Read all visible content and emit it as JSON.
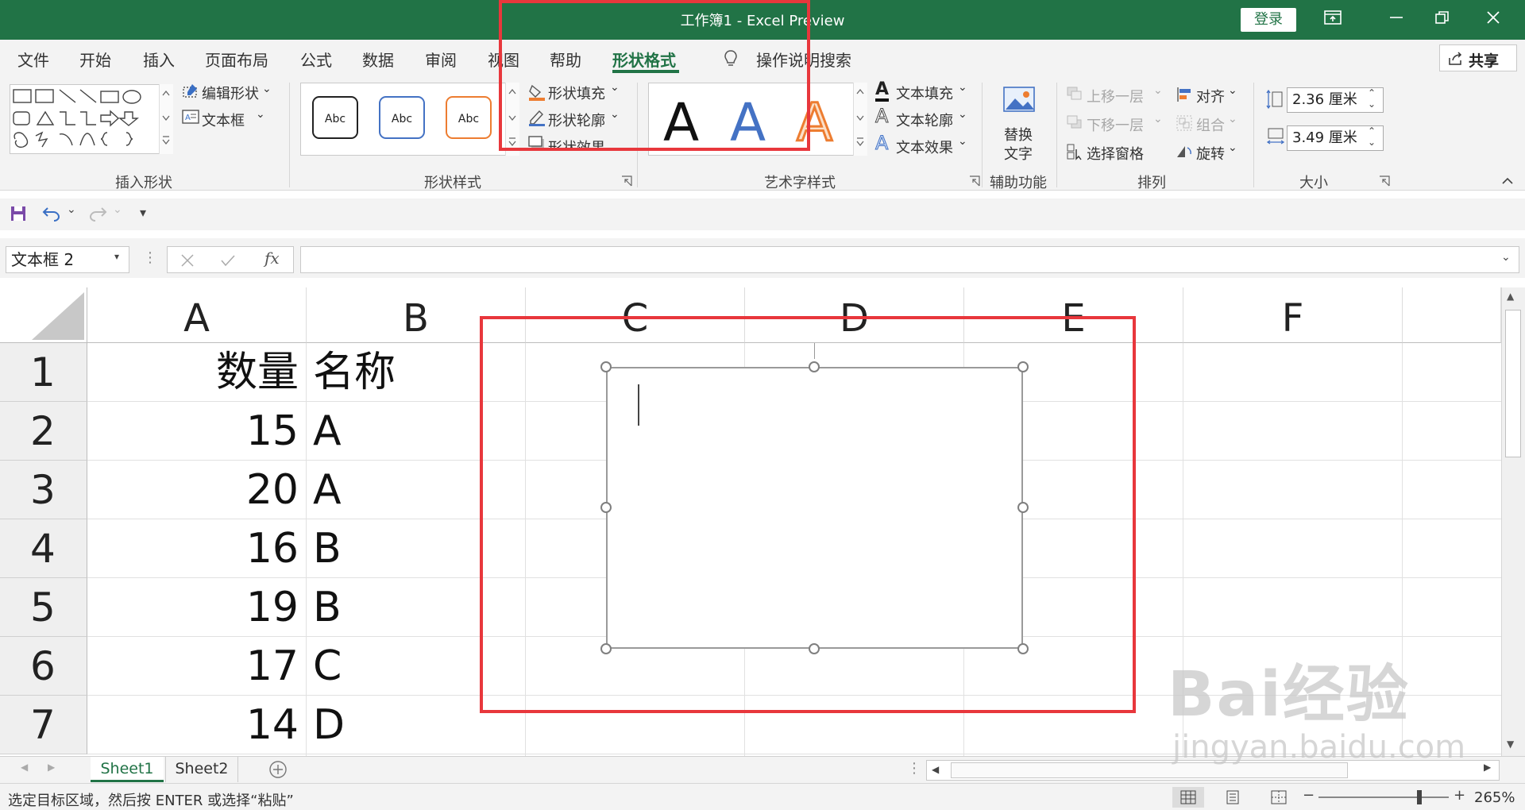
{
  "window": {
    "title": "工作簿1  -  Excel Preview",
    "login_label": "登录"
  },
  "menu": {
    "items": [
      "文件",
      "开始",
      "插入",
      "页面布局",
      "公式",
      "数据",
      "审阅",
      "视图",
      "帮助",
      "形状格式"
    ],
    "active": "形状格式",
    "tell_me": "操作说明搜索",
    "share_label": "共享"
  },
  "ribbon": {
    "insert_shapes": {
      "label": "插入形状",
      "edit_shape": "编辑形状",
      "text_box": "文本框"
    },
    "shape_styles": {
      "label": "形状样式",
      "samples": [
        "Abc",
        "Abc",
        "Abc"
      ],
      "fill": "形状填充",
      "outline": "形状轮廓",
      "effects": "形状效果"
    },
    "wordart": {
      "label": "艺术字样式",
      "samples": [
        "A",
        "A",
        "A"
      ],
      "text_fill": "文本填充",
      "text_outline": "文本轮廓",
      "text_effects": "文本效果"
    },
    "accessibility": {
      "label": "辅助功能",
      "alt_text_line1": "替换",
      "alt_text_line2": "文字"
    },
    "arrange": {
      "label": "排列",
      "bring_forward": "上移一层",
      "send_backward": "下移一层",
      "selection_pane": "选择窗格",
      "align": "对齐",
      "group": "组合",
      "rotate": "旋转"
    },
    "size": {
      "label": "大小",
      "height": "2.36 厘米",
      "width": "3.49 厘米"
    }
  },
  "formula_bar": {
    "name_box": "文本框 2",
    "fx": "fx",
    "value": ""
  },
  "grid": {
    "columns": [
      "A",
      "B",
      "C",
      "D",
      "E",
      "F"
    ],
    "rows": [
      "1",
      "2",
      "3",
      "4",
      "5",
      "6",
      "7"
    ],
    "col_a": [
      "数量",
      "15",
      "20",
      "16",
      "19",
      "17",
      "14"
    ],
    "col_b": [
      "名称",
      "A",
      "A",
      "B",
      "B",
      "C",
      "D"
    ]
  },
  "sheets": {
    "tabs": [
      "Sheet1",
      "Sheet2"
    ],
    "active": "Sheet1"
  },
  "status": {
    "message": "选定目标区域，然后按 ENTER 或选择“粘贴”",
    "zoom": "265%"
  },
  "watermark": {
    "text": "Bai经验",
    "url": "jingyan.baidu.com"
  },
  "colors": {
    "excel_green": "#217346",
    "highlight_red": "#e8373c"
  }
}
